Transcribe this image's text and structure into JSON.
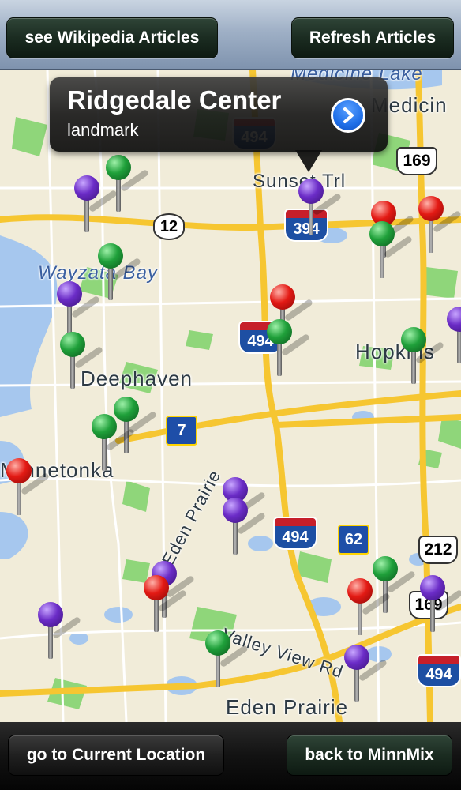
{
  "toolbar": {
    "left_button": "see Wikipedia Articles",
    "right_button": "Refresh Articles"
  },
  "bottom_bar": {
    "left_button": "go to Current Location",
    "right_button": "back to MinnMix"
  },
  "callout": {
    "title": "Ridgedale Center",
    "subtitle": "landmark",
    "disclosure_icon": "chevron-right-icon"
  },
  "map": {
    "labels": {
      "medicine_lake": "Medicine Lake",
      "medicine": "Medicin",
      "sunset_trl": "Sunset Trl",
      "wayzata_bay": "Wayzata Bay",
      "deephaven": "Deephaven",
      "hopkins": "Hopkins",
      "minnetonka": "Minnetonka",
      "eden_prairie_rd": "Eden Prairie",
      "valley_view": "Valley View Rd",
      "eden_prairie": "Eden Prairie"
    },
    "shields": {
      "i494_top": "494",
      "us169_top": "169",
      "us12": "12",
      "i394": "394",
      "i494_mid": "494",
      "mn7": "7",
      "i494_low": "494",
      "mn62": "62",
      "us212": "212",
      "us169_low": "169",
      "i494_bottom": "494"
    }
  },
  "colors": {
    "pin_red": "#e31a14",
    "pin_green": "#1fa03a",
    "pin_purple": "#6b2cc7",
    "water": "#a6c7ee",
    "park": "#8fd67a",
    "freeway": "#f6c631"
  }
}
